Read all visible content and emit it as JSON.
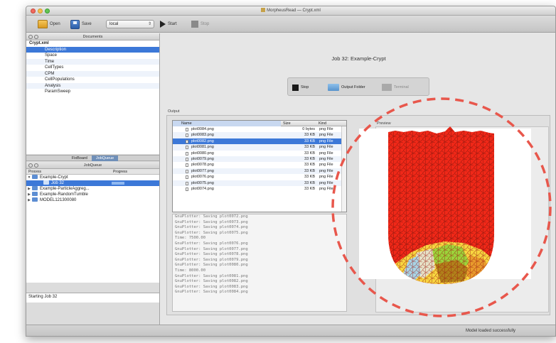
{
  "window": {
    "title": "MorpheusRead — Crypt.xml"
  },
  "toolbar": {
    "open_label": "Open",
    "save_label": "Save",
    "executor": "local",
    "start_label": "Start",
    "stop_label": "Stop"
  },
  "documents": {
    "header": "Documents",
    "root": "Crypt.xml",
    "items": [
      "Description",
      "Space",
      "Time",
      "CellTypes",
      "CPM",
      "CellPopulations",
      "Analysis",
      "ParamSweep"
    ]
  },
  "tabs": {
    "fix_board": "FixBoard",
    "job_queue": "JobQueue"
  },
  "job_queue": {
    "header": "JobQueue",
    "col_process": "Process",
    "col_progress": "Progress",
    "rows": [
      "Example-Crypt",
      "Job 32",
      "Example-ParticleAggreg...",
      "Example-RandomTumble",
      "MODEL121300080"
    ]
  },
  "log": {
    "message": "Starting Job 32"
  },
  "job": {
    "title": "Job 32: Example-Crypt",
    "stop_label": "Stop",
    "output_folder_label": "Output Folder",
    "terminal_label": "Terminal"
  },
  "output": {
    "label": "Output",
    "col_name": "Name",
    "col_size": "Size",
    "col_kind": "Kind",
    "files": [
      {
        "name": "plot0084.png",
        "size": "0 bytes",
        "kind": "png File"
      },
      {
        "name": "plot0083.png",
        "size": "33 KB",
        "kind": "png File"
      },
      {
        "name": "plot0082.png",
        "size": "33 KB",
        "kind": "png File"
      },
      {
        "name": "plot0081.png",
        "size": "33 KB",
        "kind": "png File"
      },
      {
        "name": "plot0080.png",
        "size": "33 KB",
        "kind": "png File"
      },
      {
        "name": "plot0079.png",
        "size": "33 KB",
        "kind": "png File"
      },
      {
        "name": "plot0078.png",
        "size": "33 KB",
        "kind": "png File"
      },
      {
        "name": "plot0077.png",
        "size": "33 KB",
        "kind": "png File"
      },
      {
        "name": "plot0076.png",
        "size": "33 KB",
        "kind": "png File"
      },
      {
        "name": "plot0075.png",
        "size": "33 KB",
        "kind": "png File"
      },
      {
        "name": "plot0074.png",
        "size": "33 KB",
        "kind": "png File"
      }
    ],
    "console": [
      "GnuPlotter: Saving plot0072.png",
      "GnuPlotter: Saving plot0073.png",
      "GnuPlotter: Saving plot0074.png",
      "GnuPlotter: Saving plot0075.png",
      "Time: 7500.00",
      "GnuPlotter: Saving plot0076.png",
      "GnuPlotter: Saving plot0077.png",
      "GnuPlotter: Saving plot0078.png",
      "GnuPlotter: Saving plot0079.png",
      "GnuPlotter: Saving plot0080.png",
      "Time: 8000.00",
      "GnuPlotter: Saving plot0081.png",
      "GnuPlotter: Saving plot0082.png",
      "GnuPlotter: Saving plot0083.png",
      "GnuPlotter: Saving plot0084.png"
    ]
  },
  "preview": {
    "label": "Preview"
  },
  "colors": {
    "crypt_cells": "#f02818",
    "selection": "#3c78d8",
    "callout": "#e8574c"
  },
  "status": {
    "message": "Model loaded successfully"
  }
}
